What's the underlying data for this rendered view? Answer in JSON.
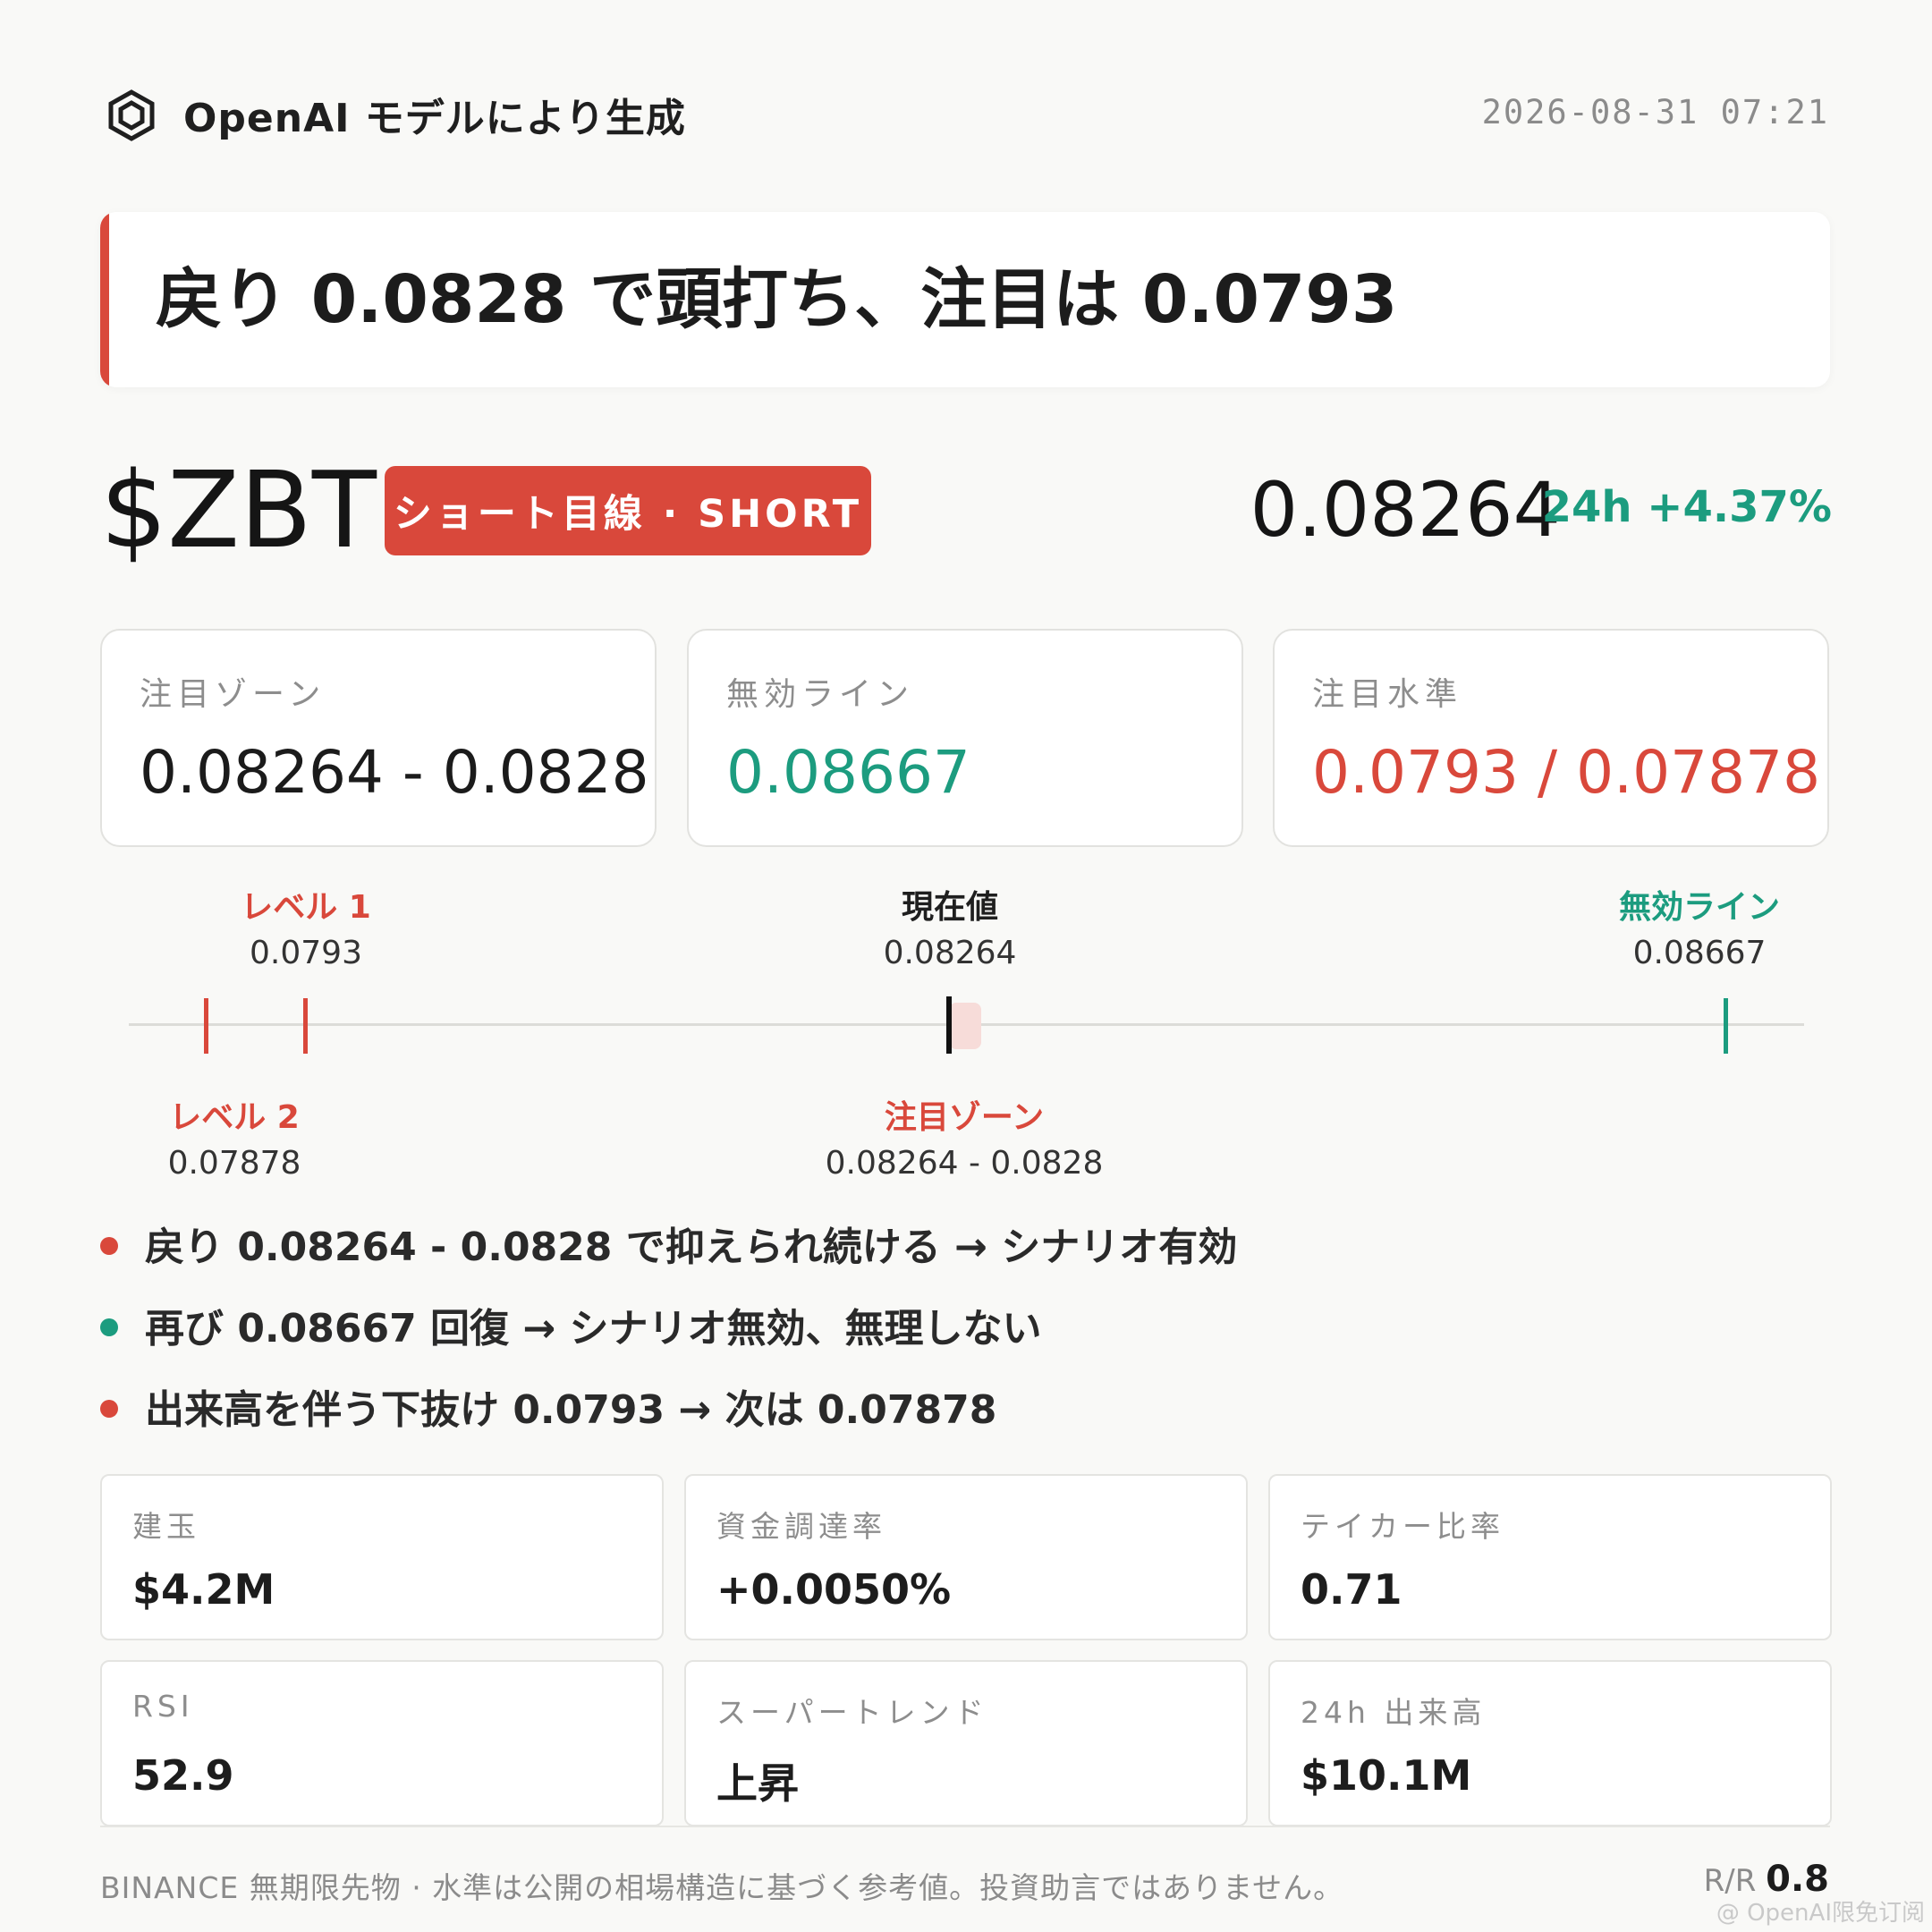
{
  "header": {
    "brand": "OpenAI モデルにより生成",
    "timestamp": "2026-08-31 07:21"
  },
  "headline": "戻り 0.0828 で頭打ち、注目は 0.0793",
  "ticker": {
    "symbol": "$ZBT",
    "badge": "ショート目線 · SHORT",
    "price": "0.08264",
    "change": "24h +4.37%"
  },
  "cards": [
    {
      "label": "注目ゾーン",
      "value": "0.08264 - 0.0828",
      "color": "#1b1b1b"
    },
    {
      "label": "無効ライン",
      "value": "0.08667",
      "color": "#1c9c7f"
    },
    {
      "label": "注目水準",
      "value": "0.0793 / 0.07878",
      "color": "#d9483b"
    }
  ],
  "levels": {
    "level1": {
      "label": "レベル 1",
      "value": "0.0793"
    },
    "level2": {
      "label": "レベル 2",
      "value": "0.07878"
    },
    "current": {
      "label": "現在値",
      "value": "0.08264"
    },
    "zone": {
      "label": "注目ゾーン",
      "value": "0.08264 - 0.0828"
    },
    "invalid": {
      "label": "無効ライン",
      "value": "0.08667"
    }
  },
  "bullets": [
    {
      "text": "戻り 0.08264 - 0.0828 で抑えられ続ける → シナリオ有効",
      "color": "#d9483b"
    },
    {
      "text": "再び 0.08667 回復 → シナリオ無効、無理しない",
      "color": "#1c9c7f"
    },
    {
      "text": "出来高を伴う下抜け 0.0793 → 次は 0.07878",
      "color": "#d9483b"
    }
  ],
  "stats": [
    {
      "label": "建玉",
      "value": "$4.2M"
    },
    {
      "label": "資金調達率",
      "value": "+0.0050%"
    },
    {
      "label": "テイカー比率",
      "value": "0.71"
    },
    {
      "label": "RSI",
      "value": "52.9"
    },
    {
      "label": "スーパートレンド",
      "value": "上昇"
    },
    {
      "label": "24h 出来高",
      "value": "$10.1M"
    }
  ],
  "footer": {
    "disclaimer": "BINANCE 無期限先物 · 水準は公開の相場構造に基づく参考値。投資助言ではありません。",
    "rr_label": "R/R",
    "rr_value": "0.8",
    "watermark": "@ OpenAI限免订阅"
  },
  "colors": {
    "red": "#d9483b",
    "green": "#1c9c7f"
  }
}
